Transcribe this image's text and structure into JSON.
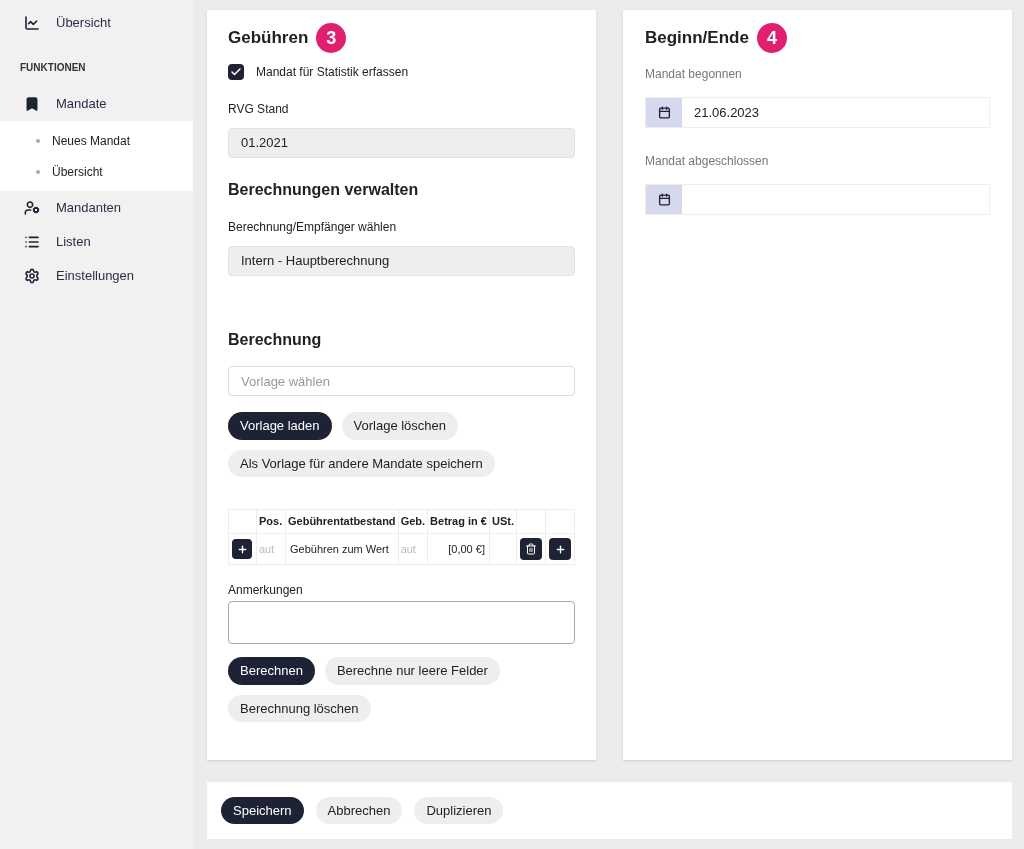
{
  "sidebar": {
    "items": [
      {
        "kind": "link",
        "label": "Übersicht"
      },
      {
        "kind": "header",
        "label": "FUNKTIONEN"
      },
      {
        "kind": "link",
        "label": "Mandate",
        "expanded": true,
        "children": [
          {
            "label": "Neues Mandat"
          },
          {
            "label": "Übersicht"
          }
        ]
      },
      {
        "kind": "link",
        "label": "Mandanten"
      },
      {
        "kind": "link",
        "label": "Listen"
      },
      {
        "kind": "link",
        "label": "Einstellungen"
      }
    ]
  },
  "fees": {
    "title": "Gebühren",
    "badge": "3",
    "statistics": {
      "label": "Mandat für Statistik erfassen",
      "checked": true
    },
    "rvg": {
      "label": "RVG Stand",
      "value": "01.2021"
    },
    "manage_title": "Berechnungen verwalten",
    "recipient": {
      "label": "Berechnung/Empfänger wählen",
      "value": "Intern - Hauptberechnung"
    },
    "calc_title": "Berechnung",
    "template": {
      "placeholder": "Vorlage wählen"
    },
    "template_buttons": [
      {
        "label": "Vorlage laden",
        "primary": true
      },
      {
        "label": "Vorlage löschen",
        "primary": false
      },
      {
        "label": "Als Vorlage für andere Mandate speichern",
        "primary": false
      }
    ],
    "table": {
      "columns": [
        "Pos.",
        "Gebührentatbestand",
        "Geb.",
        "Betrag in €",
        "USt."
      ],
      "rows": [
        {
          "pos": {
            "placeholder": "aut"
          },
          "item": "Gebühren zum Wert",
          "fee": {
            "placeholder": "aut"
          },
          "amount": "[0,00 €]"
        }
      ]
    },
    "notes": {
      "label": "Anmerkungen"
    },
    "calc_buttons": [
      {
        "label": "Berechnen",
        "primary": true
      },
      {
        "label": "Berechne nur leere Felder",
        "primary": false
      },
      {
        "label": "Berechnung löschen",
        "primary": false
      }
    ]
  },
  "dates": {
    "title": "Beginn/Ende",
    "badge": "4",
    "fields": [
      {
        "label": "Mandat begonnen",
        "value": "21.06.2023"
      },
      {
        "label": "Mandat abgeschlossen"
      }
    ]
  },
  "footer_buttons": [
    {
      "label": "Speichern",
      "primary": true
    },
    {
      "label": "Abbrechen",
      "primary": false
    },
    {
      "label": "Duplizieren",
      "primary": false
    }
  ]
}
